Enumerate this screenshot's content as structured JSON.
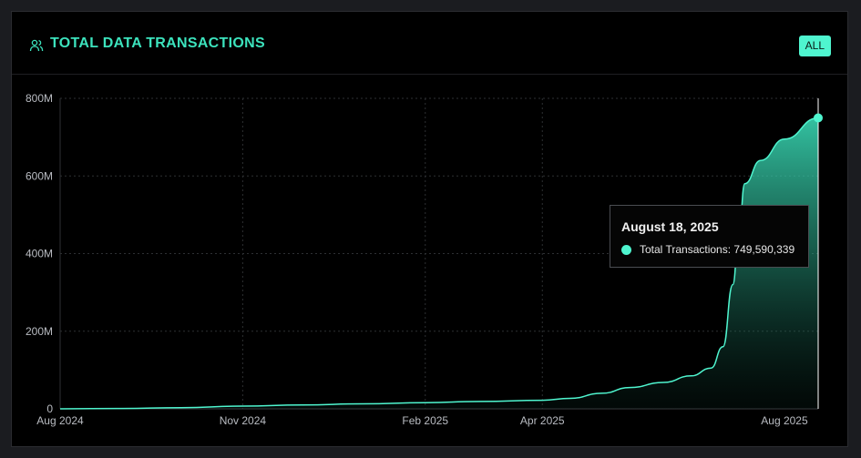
{
  "header": {
    "title": "TOTAL DATA TRANSACTIONS",
    "icon": "users-icon",
    "range_button": "ALL"
  },
  "colors": {
    "accent": "#4ff5cf",
    "title": "#3ce3bd",
    "background": "#000000"
  },
  "tooltip": {
    "date": "August 18, 2025",
    "series_label": "Total Transactions:",
    "value_text": "749,590,339"
  },
  "chart_data": {
    "type": "area",
    "title": "",
    "xlabel": "",
    "ylabel": "",
    "ylim": [
      0,
      800000000
    ],
    "xlim": [
      "2024-08-01",
      "2025-08-18"
    ],
    "grid": true,
    "y_ticks": [
      {
        "value": 0,
        "label": "0"
      },
      {
        "value": 200000000,
        "label": "200M"
      },
      {
        "value": 400000000,
        "label": "400M"
      },
      {
        "value": 600000000,
        "label": "600M"
      },
      {
        "value": 800000000,
        "label": "800M"
      }
    ],
    "x_ticks": [
      {
        "date": "2024-08-01",
        "label": "Aug 2024"
      },
      {
        "date": "2024-11-01",
        "label": "Nov 2024"
      },
      {
        "date": "2025-02-01",
        "label": "Feb 2025"
      },
      {
        "date": "2025-04-01",
        "label": "Apr 2025"
      },
      {
        "date": "2025-08-01",
        "label": "Aug 2025"
      }
    ],
    "series": [
      {
        "values": [
          {
            "x": "2024-08-01",
            "y": 0
          },
          {
            "x": "2024-09-01",
            "y": 1000000
          },
          {
            "x": "2024-10-01",
            "y": 3000000
          },
          {
            "x": "2024-11-01",
            "y": 7000000
          },
          {
            "x": "2024-12-01",
            "y": 10000000
          },
          {
            "x": "2025-01-01",
            "y": 13000000
          },
          {
            "x": "2025-02-01",
            "y": 16000000
          },
          {
            "x": "2025-03-01",
            "y": 19000000
          },
          {
            "x": "2025-04-01",
            "y": 22000000
          },
          {
            "x": "2025-04-15",
            "y": 27000000
          },
          {
            "x": "2025-05-01",
            "y": 40000000
          },
          {
            "x": "2025-05-15",
            "y": 55000000
          },
          {
            "x": "2025-06-01",
            "y": 68000000
          },
          {
            "x": "2025-06-15",
            "y": 85000000
          },
          {
            "x": "2025-06-25",
            "y": 105000000
          },
          {
            "x": "2025-07-01",
            "y": 160000000
          },
          {
            "x": "2025-07-06",
            "y": 320000000
          },
          {
            "x": "2025-07-09",
            "y": 450000000
          },
          {
            "x": "2025-07-12",
            "y": 580000000
          },
          {
            "x": "2025-07-20",
            "y": 640000000
          },
          {
            "x": "2025-08-01",
            "y": 695000000
          },
          {
            "x": "2025-08-18",
            "y": 749590339
          }
        ]
      }
    ]
  }
}
